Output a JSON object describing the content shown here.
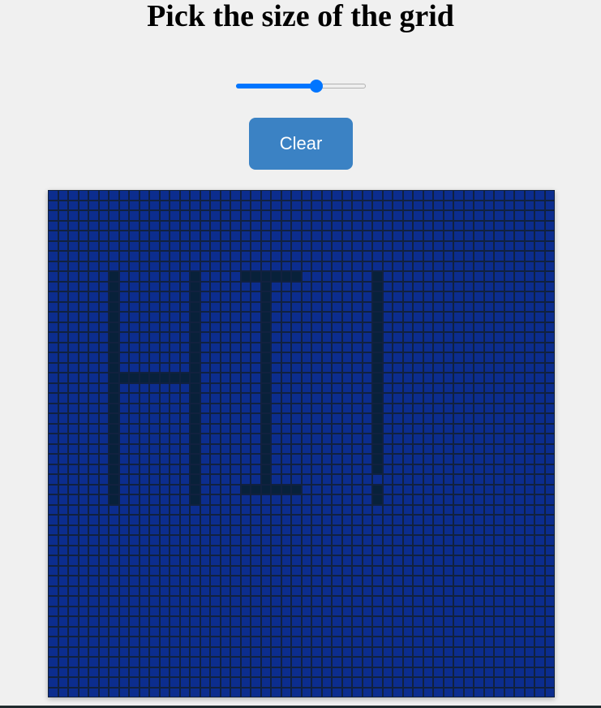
{
  "page": {
    "title": "Pick the size of the grid"
  },
  "size_slider": {
    "value": 50,
    "min": 1,
    "max": 80
  },
  "clear_button": {
    "label": "Clear"
  },
  "grid": {
    "size": 50,
    "cell_color": "#0c2d8e",
    "drawn_color": "#08213a",
    "line_color": "#11213f",
    "drawn_cells": [
      [
        6,
        8
      ],
      [
        6,
        9
      ],
      [
        6,
        10
      ],
      [
        6,
        11
      ],
      [
        6,
        12
      ],
      [
        6,
        13
      ],
      [
        6,
        14
      ],
      [
        6,
        15
      ],
      [
        6,
        16
      ],
      [
        6,
        17
      ],
      [
        6,
        18
      ],
      [
        6,
        19
      ],
      [
        6,
        20
      ],
      [
        6,
        21
      ],
      [
        6,
        22
      ],
      [
        6,
        23
      ],
      [
        6,
        24
      ],
      [
        6,
        25
      ],
      [
        6,
        26
      ],
      [
        6,
        27
      ],
      [
        6,
        28
      ],
      [
        6,
        29
      ],
      [
        6,
        30
      ],
      [
        14,
        8
      ],
      [
        14,
        9
      ],
      [
        14,
        10
      ],
      [
        14,
        11
      ],
      [
        14,
        12
      ],
      [
        14,
        13
      ],
      [
        14,
        14
      ],
      [
        14,
        15
      ],
      [
        14,
        16
      ],
      [
        14,
        17
      ],
      [
        14,
        18
      ],
      [
        14,
        19
      ],
      [
        14,
        20
      ],
      [
        14,
        21
      ],
      [
        14,
        22
      ],
      [
        14,
        23
      ],
      [
        14,
        24
      ],
      [
        14,
        25
      ],
      [
        14,
        26
      ],
      [
        14,
        27
      ],
      [
        14,
        28
      ],
      [
        14,
        29
      ],
      [
        14,
        30
      ],
      [
        7,
        18
      ],
      [
        8,
        18
      ],
      [
        9,
        18
      ],
      [
        10,
        18
      ],
      [
        11,
        18
      ],
      [
        12,
        18
      ],
      [
        13,
        18
      ],
      [
        19,
        8
      ],
      [
        20,
        8
      ],
      [
        21,
        8
      ],
      [
        22,
        8
      ],
      [
        23,
        8
      ],
      [
        24,
        8
      ],
      [
        19,
        29
      ],
      [
        20,
        29
      ],
      [
        21,
        29
      ],
      [
        22,
        29
      ],
      [
        23,
        29
      ],
      [
        24,
        29
      ],
      [
        21,
        9
      ],
      [
        21,
        10
      ],
      [
        21,
        11
      ],
      [
        21,
        12
      ],
      [
        21,
        13
      ],
      [
        21,
        14
      ],
      [
        21,
        15
      ],
      [
        21,
        16
      ],
      [
        21,
        17
      ],
      [
        21,
        18
      ],
      [
        21,
        19
      ],
      [
        21,
        20
      ],
      [
        21,
        21
      ],
      [
        21,
        22
      ],
      [
        21,
        23
      ],
      [
        21,
        24
      ],
      [
        21,
        25
      ],
      [
        21,
        26
      ],
      [
        21,
        27
      ],
      [
        21,
        28
      ],
      [
        32,
        8
      ],
      [
        32,
        9
      ],
      [
        32,
        10
      ],
      [
        32,
        11
      ],
      [
        32,
        12
      ],
      [
        32,
        13
      ],
      [
        32,
        14
      ],
      [
        32,
        15
      ],
      [
        32,
        16
      ],
      [
        32,
        17
      ],
      [
        32,
        18
      ],
      [
        32,
        19
      ],
      [
        32,
        20
      ],
      [
        32,
        21
      ],
      [
        32,
        22
      ],
      [
        32,
        23
      ],
      [
        32,
        24
      ],
      [
        32,
        25
      ],
      [
        32,
        26
      ],
      [
        32,
        27
      ],
      [
        32,
        29
      ],
      [
        32,
        30
      ]
    ]
  }
}
